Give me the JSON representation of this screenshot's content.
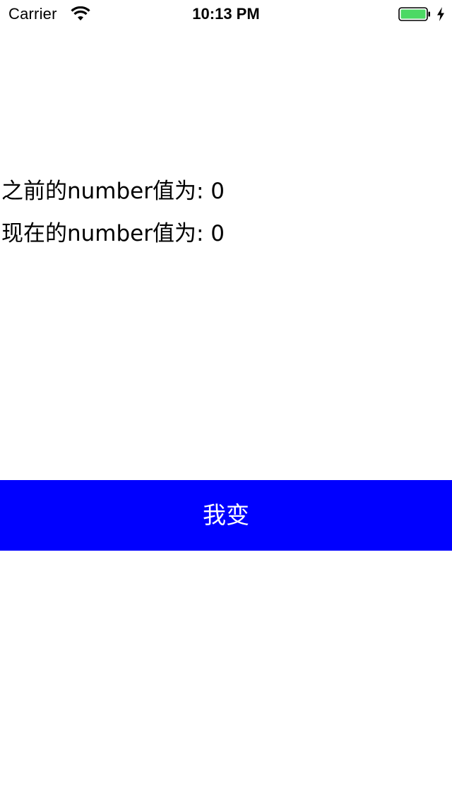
{
  "status_bar": {
    "carrier": "Carrier",
    "time": "10:13 PM",
    "wifi_icon": "wifi-icon",
    "battery_icon": "battery-full-icon",
    "charging_icon": "charging-bolt-icon",
    "battery_level": 1.0,
    "battery_color": "#4cd964"
  },
  "main": {
    "before_label": "之前的number值为: 0",
    "now_label": "现在的number值为: 0"
  },
  "button": {
    "label": "我变",
    "background": "#0000ff",
    "text_color": "#ffffff"
  }
}
